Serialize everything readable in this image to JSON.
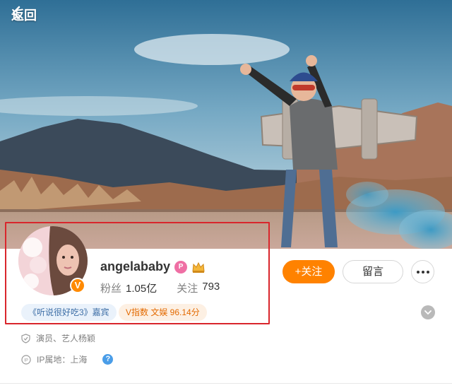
{
  "header": {
    "back_label": "返回"
  },
  "profile": {
    "name": "angelababy",
    "member_badge": "P",
    "verified_badge": "V",
    "fans_label": "粉丝",
    "fans_count": "1.05亿",
    "following_label": "关注",
    "following_count": "793"
  },
  "actions": {
    "follow_label": "+关注",
    "message_label": "留言"
  },
  "tags": {
    "guest": "《听说很好吃3》嘉宾",
    "v_index": "V指数 文娱 96.14分"
  },
  "info": {
    "occupation": "演员、艺人杨颖",
    "ip_location": "IP属地：上海",
    "help_glyph": "?"
  },
  "colors": {
    "accent_orange": "#ff8200",
    "highlight_red": "#d9262c",
    "tag_blue": "#3d6ea6",
    "tag_orange": "#e36a00"
  },
  "icons": {
    "back": "chevron-left-icon",
    "crown": "crown-icon",
    "more": "more-dots-icon",
    "expand": "chevron-down-icon",
    "occupation": "shield-icon",
    "ip": "location-ip-icon",
    "help": "help-icon"
  }
}
